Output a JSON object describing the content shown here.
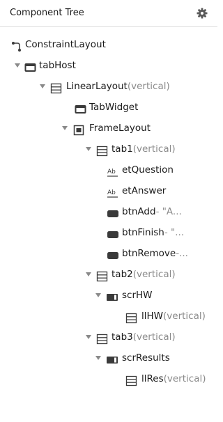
{
  "header": {
    "title": "Component Tree",
    "settings_icon": "gear-icon"
  },
  "colors": {
    "text": "#1a1a1a",
    "secondary_text": "#8a8a8a",
    "icon": "#3a3a3a",
    "divider": "#dcdcdc"
  },
  "tree": [
    {
      "name": "ConstraintLayout",
      "suffix": "",
      "icon": "constraint-layout-icon",
      "expanded": null
    },
    {
      "name": "tabHost",
      "suffix": "",
      "icon": "tabhost-icon",
      "expanded": true
    },
    {
      "name": "LinearLayout",
      "suffix": "(vertical)",
      "icon": "linear-layout-icon",
      "expanded": true
    },
    {
      "name": "TabWidget",
      "suffix": "",
      "icon": "tabwidget-icon",
      "expanded": null
    },
    {
      "name": "FrameLayout",
      "suffix": "",
      "icon": "frame-layout-icon",
      "expanded": true
    },
    {
      "name": "tab1",
      "suffix": "(vertical)",
      "icon": "linear-layout-icon",
      "expanded": true
    },
    {
      "name": "etQuestion",
      "suffix": "",
      "icon": "edittext-icon",
      "expanded": null
    },
    {
      "name": "etAnswer",
      "suffix": "",
      "icon": "edittext-icon",
      "expanded": null
    },
    {
      "name": "btnAdd",
      "suffix": "- \"A...",
      "icon": "button-icon",
      "expanded": null
    },
    {
      "name": "btnFinish",
      "suffix": "- \"...",
      "icon": "button-icon",
      "expanded": null
    },
    {
      "name": "btnRemove",
      "suffix": "-...",
      "icon": "button-icon",
      "expanded": null
    },
    {
      "name": "tab2",
      "suffix": "(vertical)",
      "icon": "linear-layout-icon",
      "expanded": true
    },
    {
      "name": "scrHW",
      "suffix": "",
      "icon": "scrollview-icon",
      "expanded": true
    },
    {
      "name": "llHW",
      "suffix": "(vertical)",
      "icon": "linear-layout-icon",
      "expanded": null
    },
    {
      "name": "tab3",
      "suffix": "(vertical)",
      "icon": "linear-layout-icon",
      "expanded": true
    },
    {
      "name": "scrResults",
      "suffix": "",
      "icon": "scrollview-icon",
      "expanded": true
    },
    {
      "name": "llRes",
      "suffix": "(vertical)",
      "icon": "linear-layout-icon",
      "expanded": null
    }
  ]
}
